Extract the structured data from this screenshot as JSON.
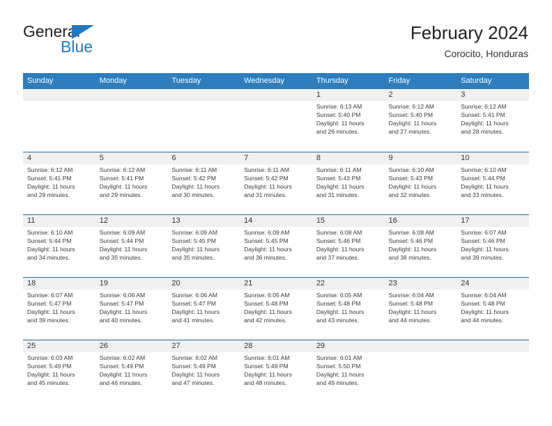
{
  "brand": {
    "word_general": "General",
    "word_blue": "Blue",
    "flag_icon": "triangle-flag-icon",
    "accent_color": "#2278be"
  },
  "header": {
    "title": "February 2024",
    "subtitle": "Corocito, Honduras"
  },
  "theme": {
    "header_blue": "#2e7ebd",
    "row_divider_blue": "#1f6cb0",
    "daynum_band_gray": "#f0f0f0",
    "text_color": "#3a3a3a"
  },
  "calendar": {
    "weekday_headers": [
      "Sunday",
      "Monday",
      "Tuesday",
      "Wednesday",
      "Thursday",
      "Friday",
      "Saturday"
    ],
    "weeks": [
      [
        {
          "day": "",
          "blank": true,
          "sunrise": "",
          "sunset": "",
          "daylight_line1": "",
          "daylight_line2": ""
        },
        {
          "day": "",
          "blank": true,
          "sunrise": "",
          "sunset": "",
          "daylight_line1": "",
          "daylight_line2": ""
        },
        {
          "day": "",
          "blank": true,
          "sunrise": "",
          "sunset": "",
          "daylight_line1": "",
          "daylight_line2": ""
        },
        {
          "day": "",
          "blank": true,
          "sunrise": "",
          "sunset": "",
          "daylight_line1": "",
          "daylight_line2": ""
        },
        {
          "day": "1",
          "blank": false,
          "sunrise": "Sunrise: 6:13 AM",
          "sunset": "Sunset: 5:40 PM",
          "daylight_line1": "Daylight: 11 hours",
          "daylight_line2": "and 26 minutes."
        },
        {
          "day": "2",
          "blank": false,
          "sunrise": "Sunrise: 6:12 AM",
          "sunset": "Sunset: 5:40 PM",
          "daylight_line1": "Daylight: 11 hours",
          "daylight_line2": "and 27 minutes."
        },
        {
          "day": "3",
          "blank": false,
          "sunrise": "Sunrise: 6:12 AM",
          "sunset": "Sunset: 5:41 PM",
          "daylight_line1": "Daylight: 11 hours",
          "daylight_line2": "and 28 minutes."
        }
      ],
      [
        {
          "day": "4",
          "blank": false,
          "sunrise": "Sunrise: 6:12 AM",
          "sunset": "Sunset: 5:41 PM",
          "daylight_line1": "Daylight: 11 hours",
          "daylight_line2": "and 29 minutes."
        },
        {
          "day": "5",
          "blank": false,
          "sunrise": "Sunrise: 6:12 AM",
          "sunset": "Sunset: 5:41 PM",
          "daylight_line1": "Daylight: 11 hours",
          "daylight_line2": "and 29 minutes."
        },
        {
          "day": "6",
          "blank": false,
          "sunrise": "Sunrise: 6:11 AM",
          "sunset": "Sunset: 5:42 PM",
          "daylight_line1": "Daylight: 11 hours",
          "daylight_line2": "and 30 minutes."
        },
        {
          "day": "7",
          "blank": false,
          "sunrise": "Sunrise: 6:11 AM",
          "sunset": "Sunset: 5:42 PM",
          "daylight_line1": "Daylight: 11 hours",
          "daylight_line2": "and 31 minutes."
        },
        {
          "day": "8",
          "blank": false,
          "sunrise": "Sunrise: 6:11 AM",
          "sunset": "Sunset: 5:43 PM",
          "daylight_line1": "Daylight: 11 hours",
          "daylight_line2": "and 31 minutes."
        },
        {
          "day": "9",
          "blank": false,
          "sunrise": "Sunrise: 6:10 AM",
          "sunset": "Sunset: 5:43 PM",
          "daylight_line1": "Daylight: 11 hours",
          "daylight_line2": "and 32 minutes."
        },
        {
          "day": "10",
          "blank": false,
          "sunrise": "Sunrise: 6:10 AM",
          "sunset": "Sunset: 5:44 PM",
          "daylight_line1": "Daylight: 11 hours",
          "daylight_line2": "and 33 minutes."
        }
      ],
      [
        {
          "day": "11",
          "blank": false,
          "sunrise": "Sunrise: 6:10 AM",
          "sunset": "Sunset: 5:44 PM",
          "daylight_line1": "Daylight: 11 hours",
          "daylight_line2": "and 34 minutes."
        },
        {
          "day": "12",
          "blank": false,
          "sunrise": "Sunrise: 6:09 AM",
          "sunset": "Sunset: 5:44 PM",
          "daylight_line1": "Daylight: 11 hours",
          "daylight_line2": "and 35 minutes."
        },
        {
          "day": "13",
          "blank": false,
          "sunrise": "Sunrise: 6:09 AM",
          "sunset": "Sunset: 5:45 PM",
          "daylight_line1": "Daylight: 11 hours",
          "daylight_line2": "and 35 minutes."
        },
        {
          "day": "14",
          "blank": false,
          "sunrise": "Sunrise: 6:09 AM",
          "sunset": "Sunset: 5:45 PM",
          "daylight_line1": "Daylight: 11 hours",
          "daylight_line2": "and 36 minutes."
        },
        {
          "day": "15",
          "blank": false,
          "sunrise": "Sunrise: 6:08 AM",
          "sunset": "Sunset: 5:46 PM",
          "daylight_line1": "Daylight: 11 hours",
          "daylight_line2": "and 37 minutes."
        },
        {
          "day": "16",
          "blank": false,
          "sunrise": "Sunrise: 6:08 AM",
          "sunset": "Sunset: 5:46 PM",
          "daylight_line1": "Daylight: 11 hours",
          "daylight_line2": "and 38 minutes."
        },
        {
          "day": "17",
          "blank": false,
          "sunrise": "Sunrise: 6:07 AM",
          "sunset": "Sunset: 5:46 PM",
          "daylight_line1": "Daylight: 11 hours",
          "daylight_line2": "and 39 minutes."
        }
      ],
      [
        {
          "day": "18",
          "blank": false,
          "sunrise": "Sunrise: 6:07 AM",
          "sunset": "Sunset: 5:47 PM",
          "daylight_line1": "Daylight: 11 hours",
          "daylight_line2": "and 39 minutes."
        },
        {
          "day": "19",
          "blank": false,
          "sunrise": "Sunrise: 6:06 AM",
          "sunset": "Sunset: 5:47 PM",
          "daylight_line1": "Daylight: 11 hours",
          "daylight_line2": "and 40 minutes."
        },
        {
          "day": "20",
          "blank": false,
          "sunrise": "Sunrise: 6:06 AM",
          "sunset": "Sunset: 5:47 PM",
          "daylight_line1": "Daylight: 11 hours",
          "daylight_line2": "and 41 minutes."
        },
        {
          "day": "21",
          "blank": false,
          "sunrise": "Sunrise: 6:05 AM",
          "sunset": "Sunset: 5:48 PM",
          "daylight_line1": "Daylight: 11 hours",
          "daylight_line2": "and 42 minutes."
        },
        {
          "day": "22",
          "blank": false,
          "sunrise": "Sunrise: 6:05 AM",
          "sunset": "Sunset: 5:48 PM",
          "daylight_line1": "Daylight: 11 hours",
          "daylight_line2": "and 43 minutes."
        },
        {
          "day": "23",
          "blank": false,
          "sunrise": "Sunrise: 6:04 AM",
          "sunset": "Sunset: 5:48 PM",
          "daylight_line1": "Daylight: 11 hours",
          "daylight_line2": "and 44 minutes."
        },
        {
          "day": "24",
          "blank": false,
          "sunrise": "Sunrise: 6:04 AM",
          "sunset": "Sunset: 5:48 PM",
          "daylight_line1": "Daylight: 11 hours",
          "daylight_line2": "and 44 minutes."
        }
      ],
      [
        {
          "day": "25",
          "blank": false,
          "sunrise": "Sunrise: 6:03 AM",
          "sunset": "Sunset: 5:49 PM",
          "daylight_line1": "Daylight: 11 hours",
          "daylight_line2": "and 45 minutes."
        },
        {
          "day": "26",
          "blank": false,
          "sunrise": "Sunrise: 6:02 AM",
          "sunset": "Sunset: 5:49 PM",
          "daylight_line1": "Daylight: 11 hours",
          "daylight_line2": "and 46 minutes."
        },
        {
          "day": "27",
          "blank": false,
          "sunrise": "Sunrise: 6:02 AM",
          "sunset": "Sunset: 5:49 PM",
          "daylight_line1": "Daylight: 11 hours",
          "daylight_line2": "and 47 minutes."
        },
        {
          "day": "28",
          "blank": false,
          "sunrise": "Sunrise: 6:01 AM",
          "sunset": "Sunset: 5:49 PM",
          "daylight_line1": "Daylight: 11 hours",
          "daylight_line2": "and 48 minutes."
        },
        {
          "day": "29",
          "blank": false,
          "sunrise": "Sunrise: 6:01 AM",
          "sunset": "Sunset: 5:50 PM",
          "daylight_line1": "Daylight: 11 hours",
          "daylight_line2": "and 49 minutes."
        },
        {
          "day": "",
          "blank": true,
          "sunrise": "",
          "sunset": "",
          "daylight_line1": "",
          "daylight_line2": ""
        },
        {
          "day": "",
          "blank": true,
          "sunrise": "",
          "sunset": "",
          "daylight_line1": "",
          "daylight_line2": ""
        }
      ]
    ]
  }
}
